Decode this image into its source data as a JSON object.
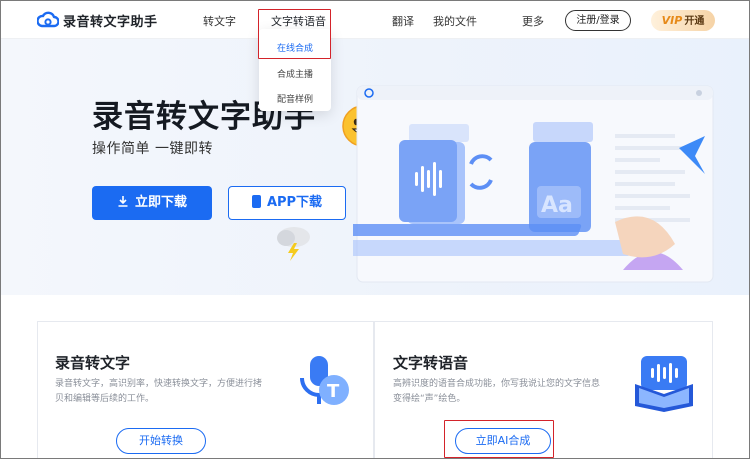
{
  "header": {
    "brand": "录音转文字助手",
    "nav": [
      "转文字",
      "文字转语音",
      "翻译",
      "我的文件",
      "更多"
    ],
    "register_login": "注册/登录",
    "vip_prefix": "VIP",
    "vip_label": "开通"
  },
  "dropdown": {
    "items": [
      "在线合成",
      "合成主播",
      "配音样例"
    ],
    "selected": "在线合成"
  },
  "hero": {
    "title": "录音转文字助手",
    "subtitle": "操作简单 一键即转",
    "download_button": "立即下载",
    "app_button": "APP下载",
    "illustration_text": "Aa"
  },
  "cards": [
    {
      "title": "录音转文字",
      "desc_line1": "录音转文字，高识别率，快速转换文字，方便进行拷",
      "desc_line2": "贝和编辑等后续的工作。",
      "button": "开始转换"
    },
    {
      "title": "文字转语音",
      "desc_line1": "高辨识度的语音合成功能，你写我说让您的文字信息",
      "desc_line2": "变得绘“声”绘色。",
      "button": "立即AI合成"
    }
  ],
  "colors": {
    "primary": "#1b6bf2",
    "highlight": "#d3232a",
    "hero_bg": "#eef3fb"
  }
}
